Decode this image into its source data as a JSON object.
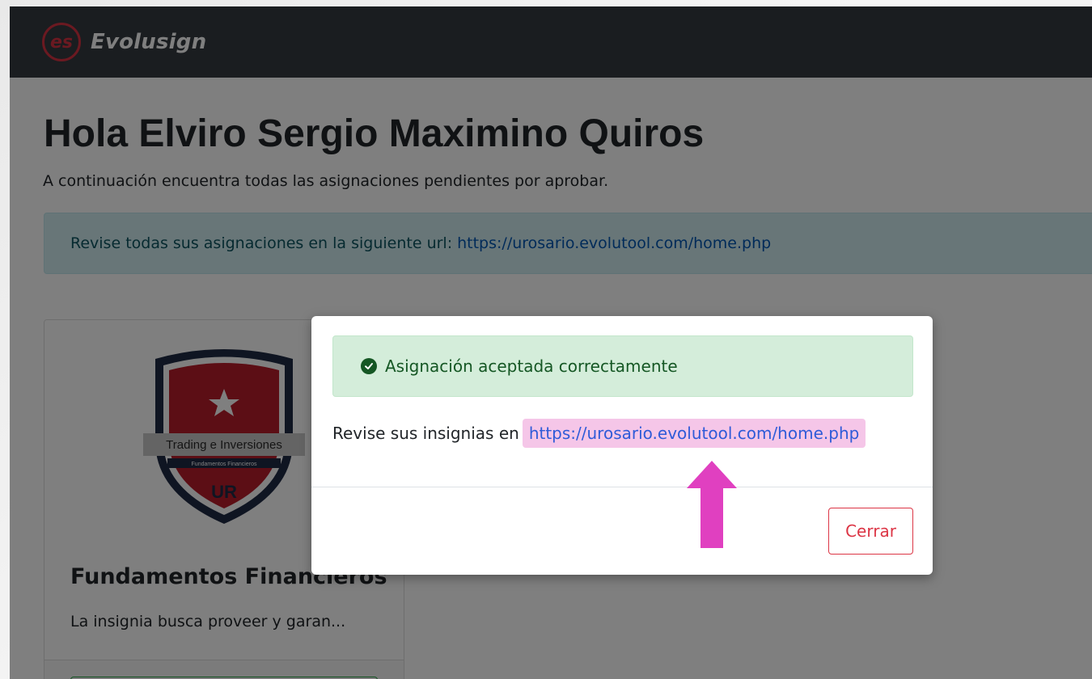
{
  "navbar": {
    "logo_text": "es",
    "brand": "Evolusign"
  },
  "page": {
    "title": "Hola Elviro Sergio Maximino Quiros",
    "subtitle": "A continuación encuentra todas las asignaciones pendientes por aprobar."
  },
  "info_alert": {
    "text": "Revise todas sus asignaciones en la siguiente url:",
    "link": "https://urosario.evolutool.com/home.php"
  },
  "card": {
    "badge_text": "Trading e Inversiones",
    "badge_subtext": "Fundamentos Financieros",
    "badge_initials": "UR",
    "title": "Fundamentos Financieros",
    "description": "La insignia busca proveer y garan..."
  },
  "modal": {
    "success_message": "Asignación aceptada correctamente",
    "body_text": "Revise sus insignias en",
    "link": "https://urosario.evolutool.com/home.php",
    "close_label": "Cerrar"
  },
  "colors": {
    "navbar": "#343a40",
    "brand_accent": "#d63342",
    "success": "#155724",
    "danger": "#dc3545",
    "highlight": "#f5c6e8",
    "arrow": "#e040c0"
  }
}
